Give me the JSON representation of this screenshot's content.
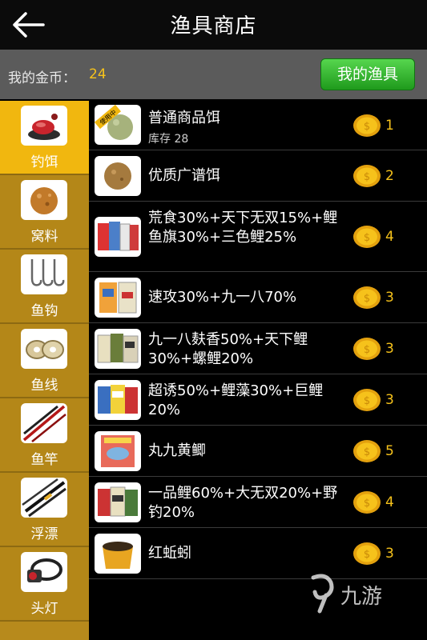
{
  "header": {
    "title": "渔具商店",
    "back_icon": "back-arrow-icon"
  },
  "coinbar": {
    "label": "我的金币：",
    "value": "24",
    "my_gear_button": "我的渔具"
  },
  "sidebar": {
    "items": [
      {
        "label": "钓饵",
        "icon": "bait-icon",
        "active": true
      },
      {
        "label": "窝料",
        "icon": "groundbait-icon"
      },
      {
        "label": "鱼钩",
        "icon": "hook-icon"
      },
      {
        "label": "鱼线",
        "icon": "fishing-line-icon"
      },
      {
        "label": "鱼竿",
        "icon": "fishing-rod-icon"
      },
      {
        "label": "浮漂",
        "icon": "float-icon"
      },
      {
        "label": "头灯",
        "icon": "headlamp-icon"
      }
    ]
  },
  "items": [
    {
      "name": "普通商品饵",
      "stock": "库存 28",
      "badge": "使用中",
      "price": "1"
    },
    {
      "name": "优质广谱饵",
      "price": "2"
    },
    {
      "name": "荒食30%+天下无双15%+鲤鱼旗30%+三色鲤25%",
      "price": "4"
    },
    {
      "name": "速攻30%+九一八70%",
      "price": "3"
    },
    {
      "name": "九一八麸香50%+天下鲤30%+螺鲤20%",
      "price": "3"
    },
    {
      "name": "超诱50%+鲤藻30%+巨鲤20%",
      "price": "3"
    },
    {
      "name": "丸九黄鲫",
      "price": "5"
    },
    {
      "name": "一品鲤60%+大无双20%+野钓20%",
      "price": "4"
    },
    {
      "name": "红蚯蚓",
      "price": "3"
    }
  ],
  "watermark": {
    "text": "九游"
  },
  "colors": {
    "accent_yellow": "#f1b70f",
    "coin_text": "#f6c21b",
    "green_button": "#2fb12a"
  }
}
